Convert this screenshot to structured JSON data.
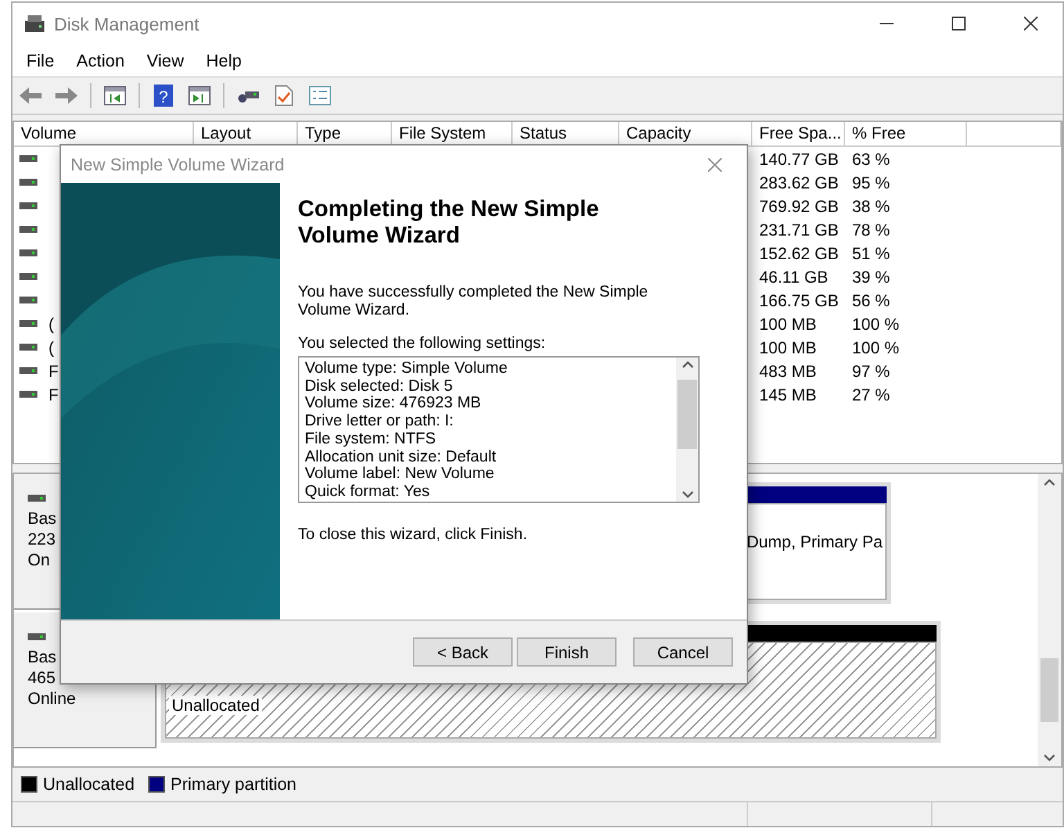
{
  "window": {
    "title": "Disk Management"
  },
  "menu": [
    "File",
    "Action",
    "View",
    "Help"
  ],
  "toolbar": {
    "help_glyph": "?"
  },
  "volume_list": {
    "columns": [
      "Volume",
      "Layout",
      "Type",
      "File System",
      "Status",
      "Capacity",
      "Free Spa...",
      "% Free"
    ],
    "rows": [
      {
        "free_space": "140.77 GB",
        "percent_free": "63 %"
      },
      {
        "free_space": "283.62 GB",
        "percent_free": "95 %"
      },
      {
        "free_space": "769.92 GB",
        "percent_free": "38 %"
      },
      {
        "free_space": "231.71 GB",
        "percent_free": "78 %"
      },
      {
        "free_space": "152.62 GB",
        "percent_free": "51 %"
      },
      {
        "free_space": "46.11 GB",
        "percent_free": "39 %"
      },
      {
        "free_space": "166.75 GB",
        "percent_free": "56 %"
      },
      {
        "volume": "(",
        "free_space": "100 MB",
        "percent_free": "100 %"
      },
      {
        "volume": "(",
        "free_space": "100 MB",
        "percent_free": "100 %"
      },
      {
        "volume": "F",
        "free_space": "483 MB",
        "percent_free": "97 %"
      },
      {
        "volume": "F",
        "free_space": "145 MB",
        "percent_free": "27 %"
      }
    ]
  },
  "disks": [
    {
      "lines": [
        "Bas",
        "223",
        "On"
      ],
      "partitions": [
        {
          "kind": "primary",
          "text": "Dump, Primary Pa"
        }
      ]
    },
    {
      "lines": [
        "Bas",
        "465",
        "Online"
      ],
      "partitions": [
        {
          "kind": "unallocated",
          "text": "Unallocated"
        }
      ]
    }
  ],
  "legend": [
    {
      "label": "Unallocated",
      "color": "#000000"
    },
    {
      "label": "Primary partition",
      "color": "#000080"
    }
  ],
  "dialog": {
    "title": "New Simple Volume Wizard",
    "heading": "Completing the New Simple Volume Wizard",
    "intro": "You have successfully completed the New Simple Volume Wizard.",
    "settings_label": "You selected the following settings:",
    "settings": [
      "Volume type: Simple Volume",
      "Disk selected: Disk 5",
      "Volume size: 476923 MB",
      "Drive letter or path: I:",
      "File system: NTFS",
      "Allocation unit size: Default",
      "Volume label: New Volume",
      "Quick format: Yes"
    ],
    "closing": "To close this wizard, click Finish.",
    "buttons": [
      "< Back",
      "Finish",
      "Cancel"
    ]
  }
}
